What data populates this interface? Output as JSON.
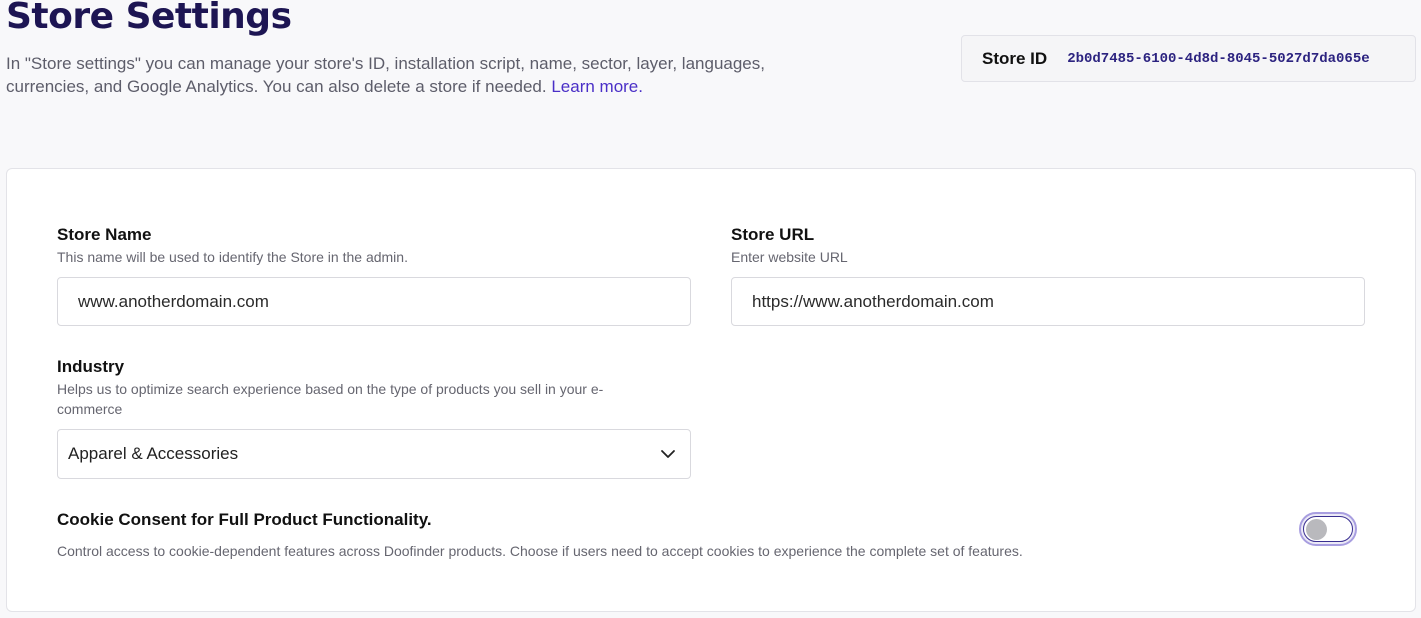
{
  "header": {
    "title": "Store Settings",
    "intro_text": "In \"Store settings\" you can manage your store's ID, installation script, name, sector, layer, languages, currencies, and Google Analytics. You can also delete a store if needed.",
    "learn_more": "Learn more."
  },
  "store_id": {
    "label": "Store ID",
    "value": "2b0d7485-6100-4d8d-8045-5027d7da065e"
  },
  "form": {
    "store_name": {
      "label": "Store Name",
      "help": "This name will be used to identify the Store in the admin.",
      "value": "www.anotherdomain.com"
    },
    "store_url": {
      "label": "Store URL",
      "help": "Enter website URL",
      "value": "https://www.anotherdomain.com"
    },
    "industry": {
      "label": "Industry",
      "help": "Helps us to optimize search experience based on the type of products you sell in your e-commerce",
      "selected": "Apparel & Accessories"
    },
    "cookie_consent": {
      "title": "Cookie Consent for Full Product Functionality.",
      "description": "Control access to cookie-dependent features across Doofinder products. Choose if users need to accept cookies to experience the complete set of features.",
      "enabled": false
    }
  },
  "colors": {
    "brand_dark": "#1d1553",
    "link": "#4a2fc7",
    "toggle_border": "#3a2f91"
  }
}
